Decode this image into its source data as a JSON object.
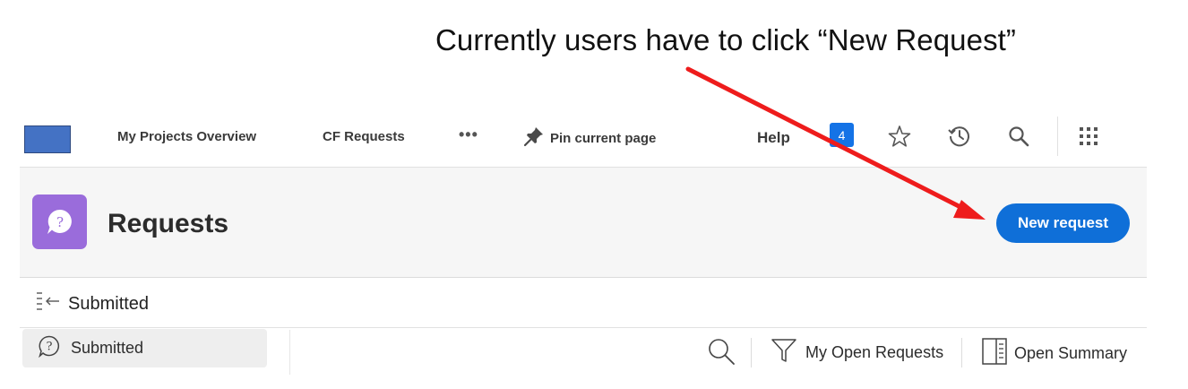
{
  "annotation": {
    "text": "Currently users have to click “New Request”",
    "arrow_color": "#ee1c1c"
  },
  "topnav": {
    "logo_color": "#4472c4",
    "links": [
      "My Projects Overview",
      "CF Requests"
    ],
    "more_label": "•••",
    "pin_label": "Pin current page",
    "help_label": "Help",
    "notification_count": "4",
    "icons": [
      "star-icon",
      "history-icon",
      "search-icon",
      "apps-grid-icon"
    ]
  },
  "header": {
    "app_icon_color": "#9a6cdb",
    "title": "Requests",
    "primary_button": "New request",
    "primary_color": "#0f6fd8"
  },
  "subheader": {
    "label": "Submitted"
  },
  "sidebar": {
    "items": [
      {
        "label": "Submitted",
        "icon": "question-bubble-icon",
        "selected": true
      }
    ]
  },
  "toolbar": {
    "filter_label": "My Open Requests",
    "summary_label": "Open Summary"
  }
}
